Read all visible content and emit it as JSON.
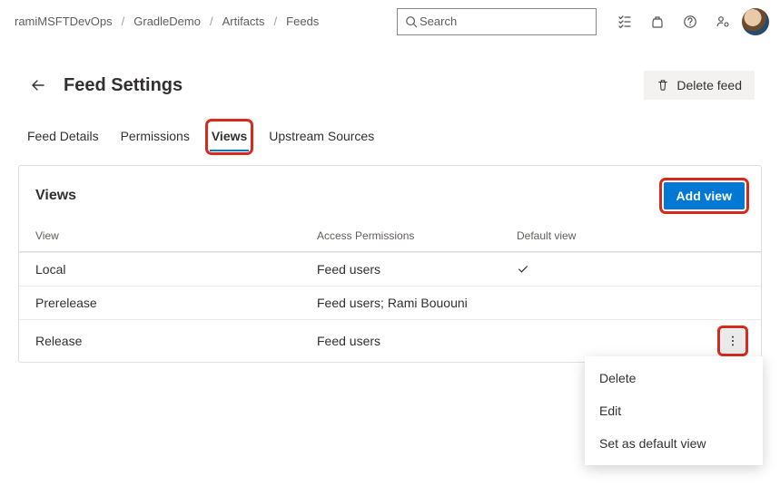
{
  "breadcrumb": {
    "items": [
      "ramiMSFTDevOps",
      "GradleDemo",
      "Artifacts",
      "Feeds"
    ]
  },
  "search": {
    "placeholder": "Search"
  },
  "header": {
    "title": "Feed Settings",
    "delete_label": "Delete feed"
  },
  "tabs": [
    {
      "label": "Feed Details",
      "active": false
    },
    {
      "label": "Permissions",
      "active": false
    },
    {
      "label": "Views",
      "active": true
    },
    {
      "label": "Upstream Sources",
      "active": false
    }
  ],
  "views_card": {
    "title": "Views",
    "add_label": "Add view",
    "columns": {
      "view": "View",
      "access": "Access Permissions",
      "default": "Default view"
    },
    "rows": [
      {
        "name": "Local",
        "access": "Feed users",
        "is_default": true
      },
      {
        "name": "Prerelease",
        "access": "Feed users; Rami Bououni",
        "is_default": false
      },
      {
        "name": "Release",
        "access": "Feed users",
        "is_default": false
      }
    ]
  },
  "context_menu": {
    "items": [
      "Delete",
      "Edit",
      "Set as default view"
    ]
  }
}
